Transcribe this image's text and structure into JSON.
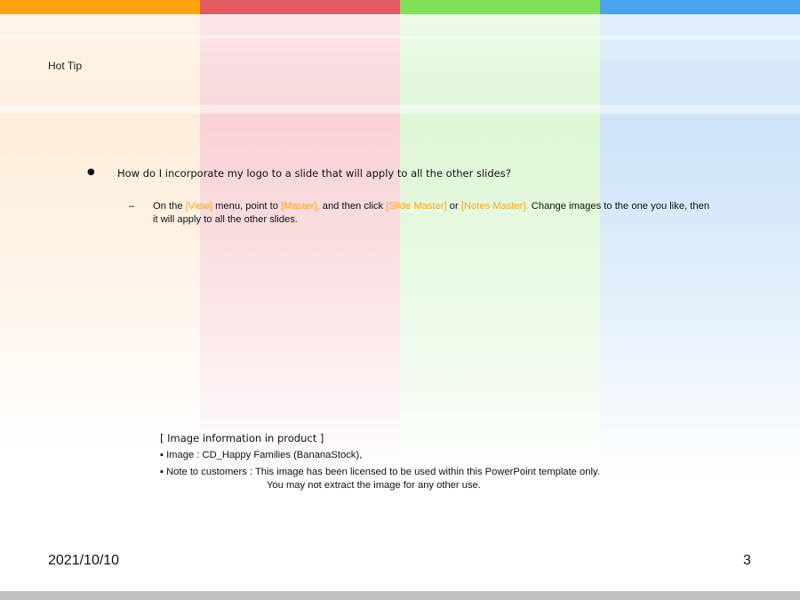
{
  "slide": {
    "title": "Hot Tip",
    "bullet": "How do I incorporate my logo to a slide that will apply to all the other slides?",
    "sub": {
      "t1": "On the ",
      "view": "[View]",
      "t2": " menu, point to ",
      "master": "[Master],",
      "t3": " and then click ",
      "slide_master": "[Slide Master]",
      "t4": " or ",
      "notes_master": "[Notes Master].",
      "t5": " Change images to the one you like, then it will apply to all the other slides."
    },
    "info": {
      "heading": "[ Image information in product ]",
      "image_line": "▪ Image : CD_Happy Families (BananaStock),",
      "note_line1": "▪ Note to customers : This image has been licensed to be used within this PowerPoint template only.",
      "note_line2": "You may not extract the image for any other use."
    },
    "date": "2021/10/10",
    "page_number": "3",
    "bullet_marker": "●",
    "dash_marker": "–"
  },
  "colors": {
    "orange": "#FDA50F",
    "red": "#E15B62",
    "green": "#7FE05A",
    "blue": "#4AA3EE",
    "highlight": "#FDA50F"
  }
}
